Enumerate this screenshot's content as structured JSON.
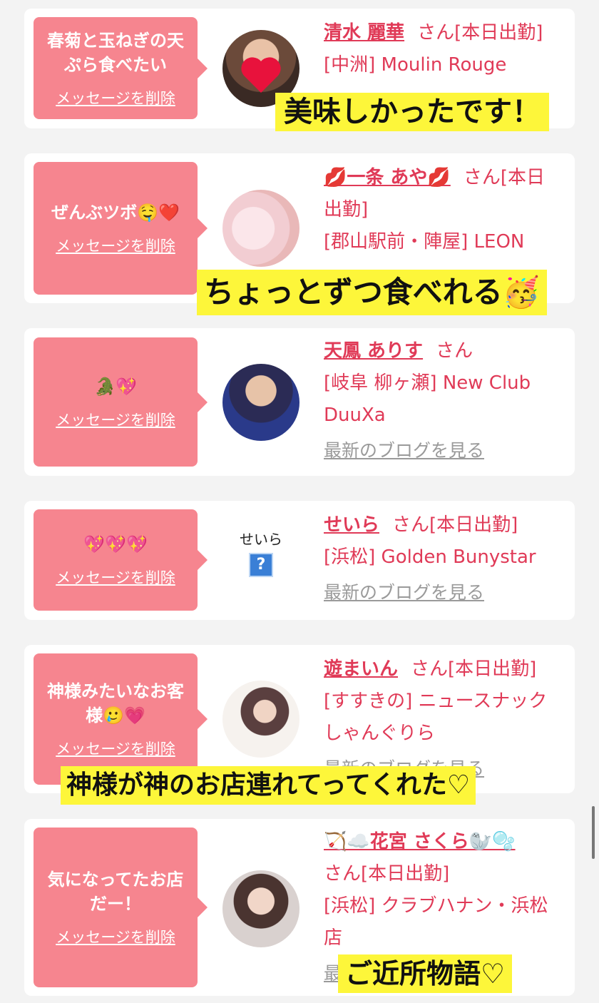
{
  "entries": [
    {
      "message": "春菊と玉ねぎの天ぷら食べたい",
      "delete_label": "メッセージを削除",
      "name": "清水 麗華",
      "suffix": "さん[本日出勤]",
      "store": "[中洲] Moulin Rouge",
      "avatar_icon": "heart-sticker-icon"
    },
    {
      "message": "ぜんぶツボ🤤❤️",
      "delete_label": "メッセージを削除",
      "name": "💋一条 あや💋",
      "suffix": "さん[本日出勤]",
      "store": "[郡山駅前・陣屋] LEON"
    },
    {
      "message": "🐊💖",
      "delete_label": "メッセージを削除",
      "name": "天鳳 ありす",
      "suffix": "さん",
      "store": "[岐阜 柳ヶ瀬] New Club DuuXa",
      "blog": "最新のブログを見る"
    },
    {
      "message": "💖💖💖",
      "delete_label": "メッセージを削除",
      "name": "せいら",
      "suffix": "さん[本日出勤]",
      "store": "[浜松] Golden Bunystar",
      "blog": "最新のブログを見る",
      "avatar_alt": "せいら",
      "avatar_icon": "broken-image-icon",
      "avatar_mark": "?"
    },
    {
      "message": "神様みたいなお客様🥲💗",
      "delete_label": "メッセージを削除",
      "name": "遊まいん",
      "suffix": "さん[本日出勤]",
      "store": "[すすきの] ニュースナック しゃんぐりら",
      "blog": "最新のブログを見る"
    },
    {
      "message": "気になってたお店だー！",
      "delete_label": "メッセージを削除",
      "name": "🏹☁️花宮 さくら🦭🫧",
      "suffix": "さん[本日出勤]",
      "store": "[浜松] クラブハナン・浜松店",
      "blog_partial": "最"
    }
  ],
  "captions": [
    "美味しかったです！",
    "ちょっとずつ食べれる🥳",
    "神様が神のお店連れてってくれた♡",
    "ご近所物語♡"
  ],
  "colors": {
    "accent": "#e03a57",
    "bubble": "#f6858f",
    "caption_bg": "#fdf63a",
    "page_bg": "#f3f3f3"
  }
}
